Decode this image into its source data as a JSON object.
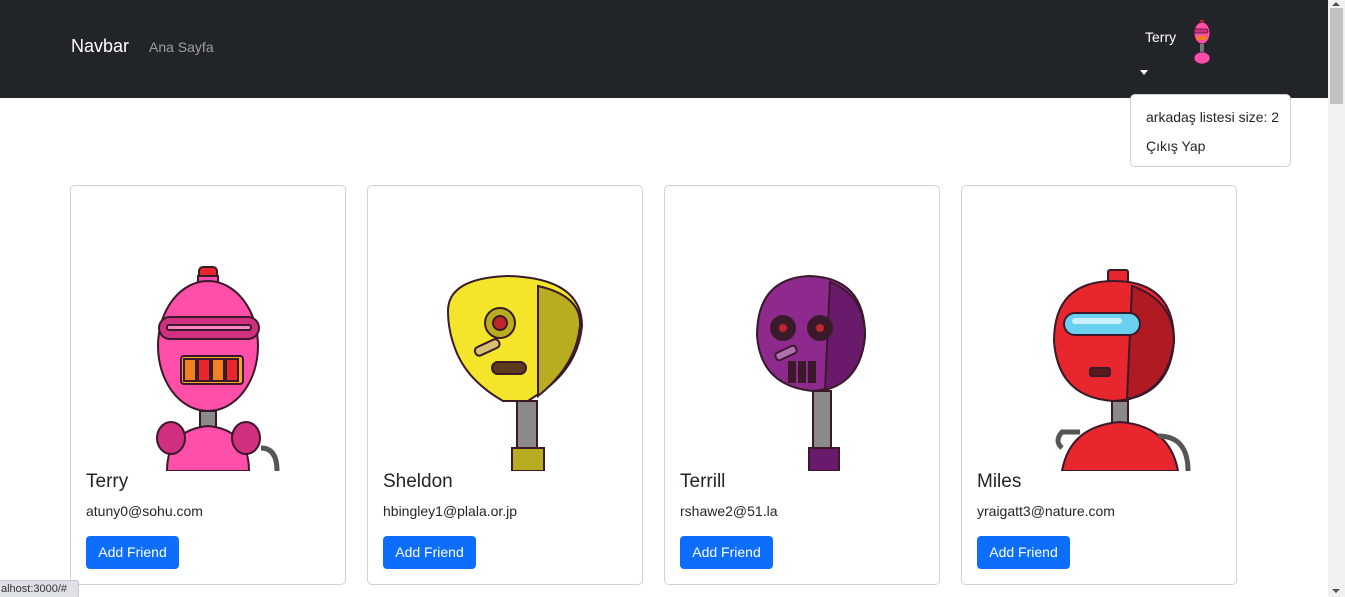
{
  "navbar": {
    "brand": "Navbar",
    "links": [
      "Ana Sayfa"
    ],
    "user": {
      "name": "Terry",
      "avatar_icon": "pink-robot-icon"
    },
    "dropdown": {
      "items": [
        "arkadaş listesi size: 2",
        "Çıkış Yap"
      ]
    }
  },
  "cards": [
    {
      "name": "Terry",
      "email": "atuny0@sohu.com",
      "button": "Add Friend",
      "robot_icon": "pink-robot-icon",
      "color": "#ff4fa8"
    },
    {
      "name": "Sheldon",
      "email": "hbingley1@plala.or.jp",
      "button": "Add Friend",
      "robot_icon": "yellow-robot-icon",
      "color": "#f5e52a"
    },
    {
      "name": "Terrill",
      "email": "rshawe2@51.la",
      "button": "Add Friend",
      "robot_icon": "purple-robot-icon",
      "color": "#8e2a8e"
    },
    {
      "name": "Miles",
      "email": "yraigatt3@nature.com",
      "button": "Add Friend",
      "robot_icon": "red-robot-icon",
      "color": "#e8262e"
    }
  ],
  "status_bar": {
    "url": "alhost:3000/#"
  },
  "colors": {
    "navbar_bg": "#212529",
    "primary": "#0d6efd"
  }
}
